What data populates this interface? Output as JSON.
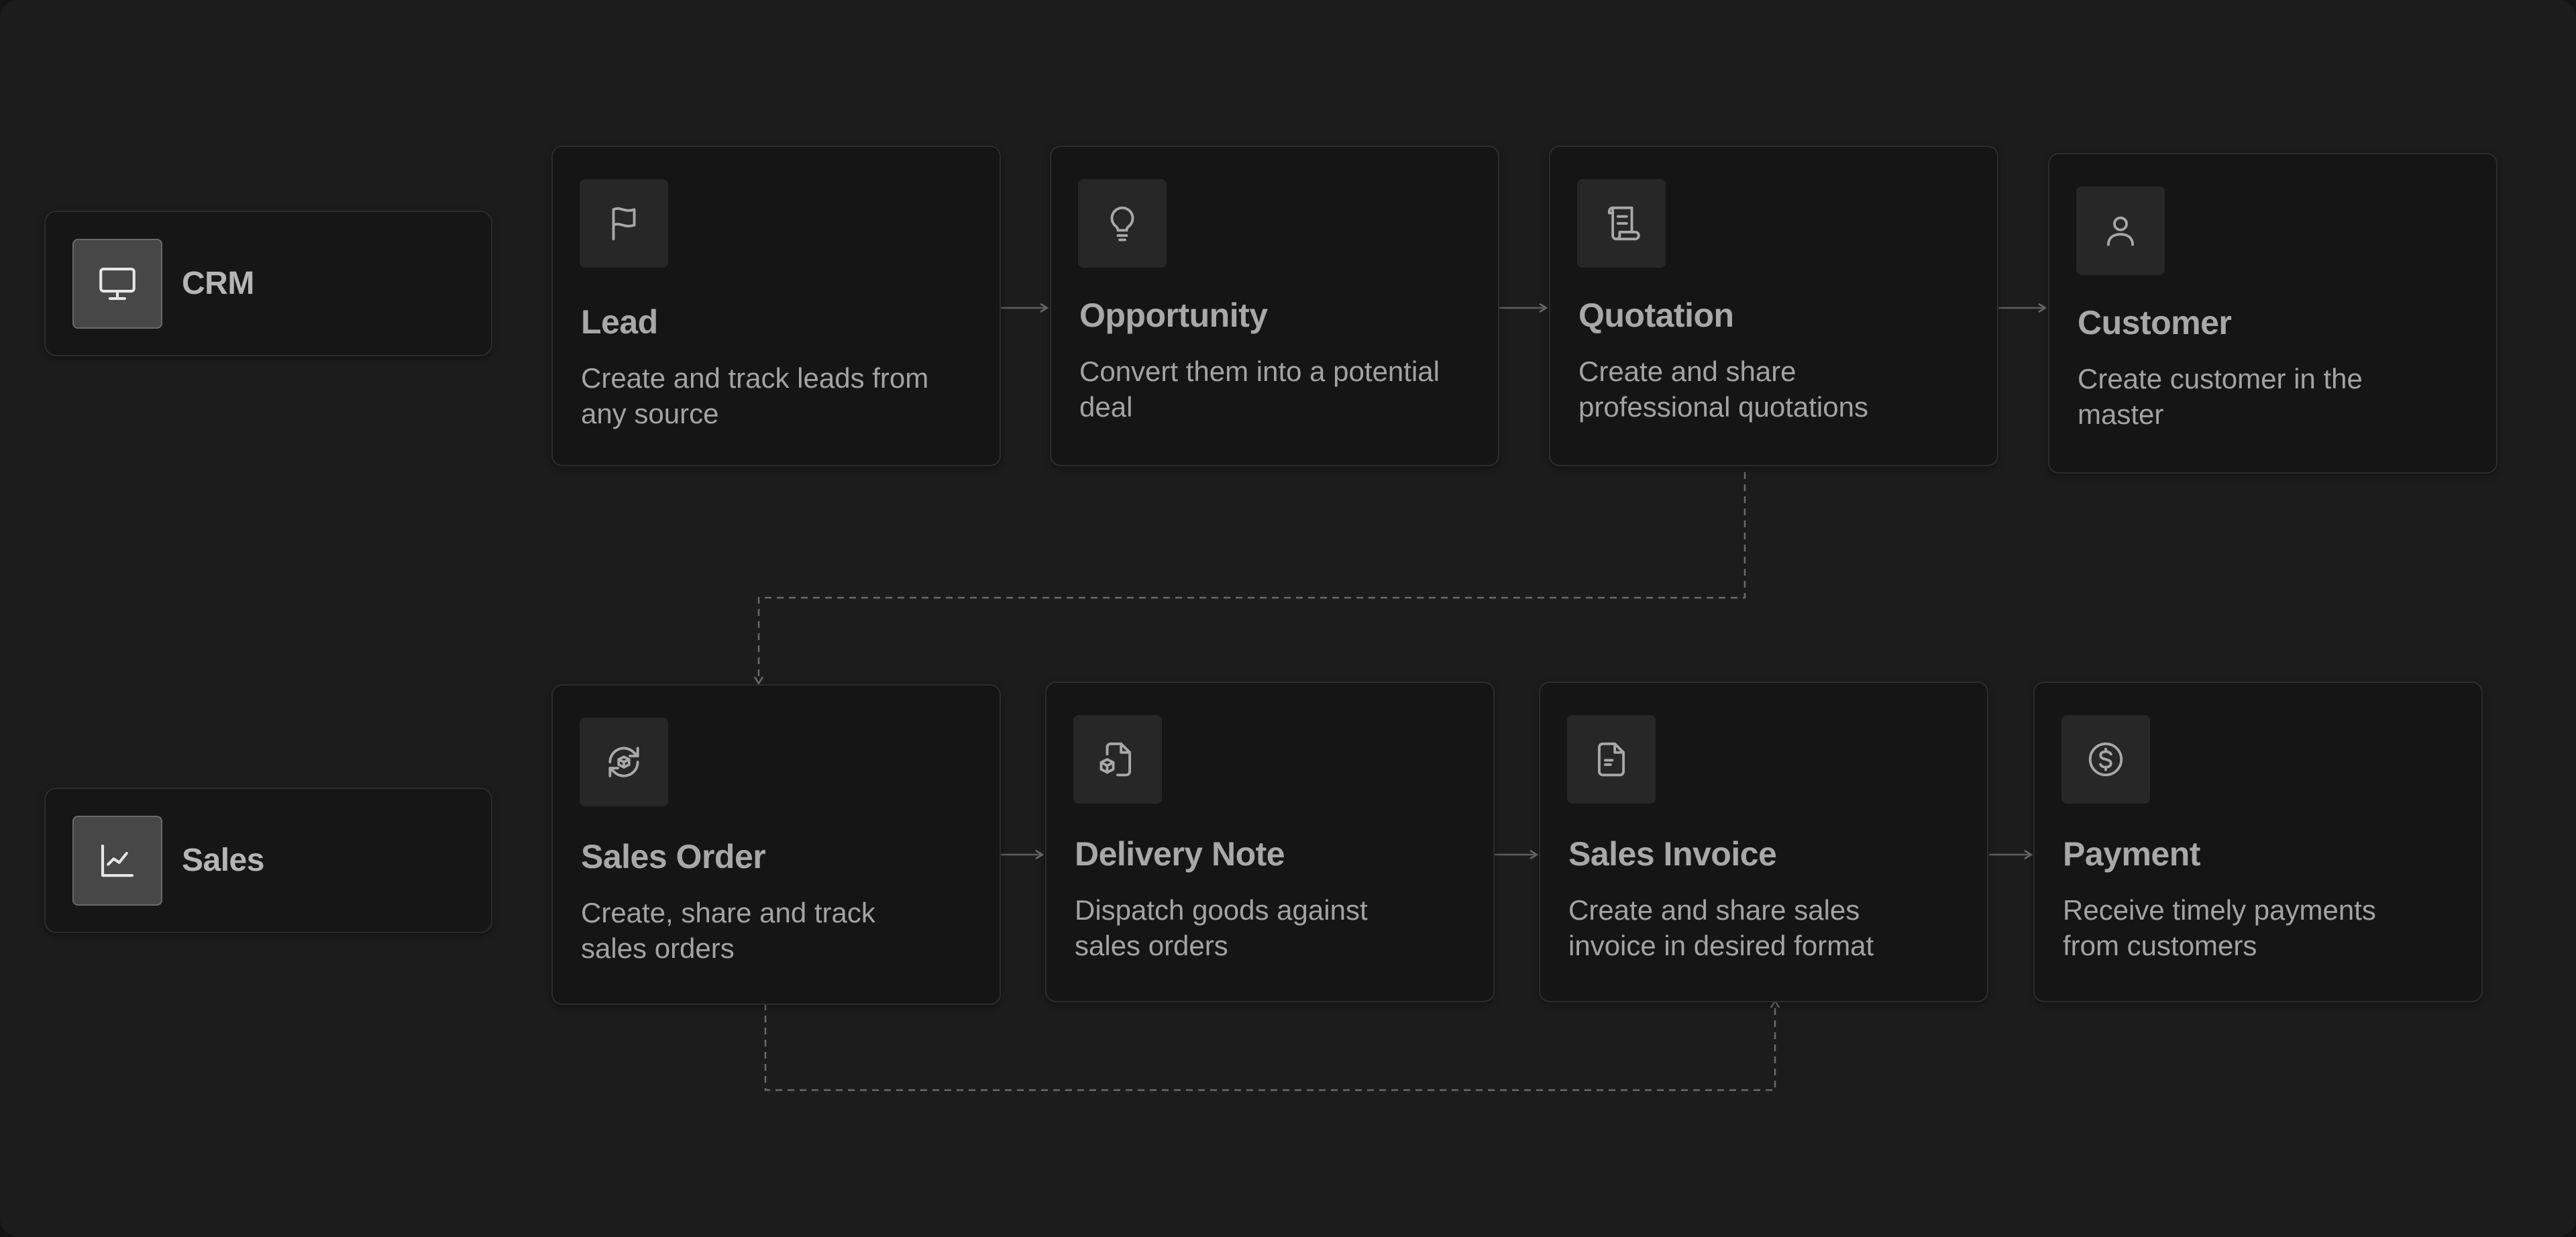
{
  "modules": [
    {
      "id": "crm",
      "label": "CRM",
      "icon": "monitor-icon"
    },
    {
      "id": "sales",
      "label": "Sales",
      "icon": "line-chart-icon"
    }
  ],
  "crm_flow": [
    {
      "title": "Lead",
      "description": "Create and track leads from any source",
      "icon": "flag-icon"
    },
    {
      "title": "Opportunity",
      "description": "Convert them into a potential deal",
      "icon": "lightbulb-icon"
    },
    {
      "title": "Quotation",
      "description": "Create and share professional quotations",
      "icon": "scroll-icon"
    },
    {
      "title": "Customer",
      "description": "Create customer in the master",
      "icon": "user-icon"
    }
  ],
  "sales_flow": [
    {
      "title": "Sales Order",
      "description": "Create, share and track sales orders",
      "icon": "refresh-box-icon"
    },
    {
      "title": "Delivery Note",
      "description": "Dispatch goods against sales orders",
      "icon": "file-box-icon"
    },
    {
      "title": "Sales Invoice",
      "description": "Create and share sales invoice in desired format",
      "icon": "file-text-icon"
    },
    {
      "title": "Payment",
      "description": "Receive timely payments from customers",
      "icon": "dollar-circle-icon"
    }
  ],
  "colors": {
    "background": "#1c1c1c",
    "card": "#151515",
    "border": "#2c2c2c",
    "text": "#a8a8a8",
    "connector": "#6a6a6a"
  }
}
